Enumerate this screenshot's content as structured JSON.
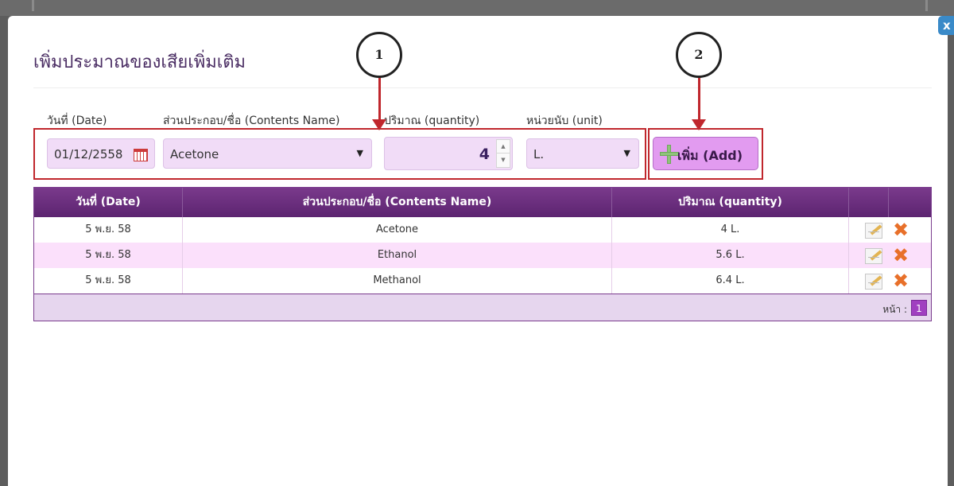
{
  "modal": {
    "title": "เพิ่มประมาณของเสียเพิ่มเติม",
    "close_label": "x"
  },
  "form": {
    "date_label": "วันที่ (Date)",
    "contents_label": "ส่วนประกอบ/ชื่อ (Contents Name)",
    "quantity_label": "ปริมาณ (quantity)",
    "unit_label": "หน่วยนับ (unit)",
    "date_value": "01/12/2558",
    "contents_value": "Acetone",
    "quantity_value": "4",
    "unit_value": "L.",
    "add_label": "เพิ่ม (Add)"
  },
  "annotations": {
    "marker_1": "1",
    "marker_2": "2",
    "color": "#c0272d"
  },
  "table": {
    "headers": [
      "วันที่ (Date)",
      "ส่วนประกอบ/ชื่อ (Contents Name)",
      "ปริมาณ (quantity)"
    ],
    "rows": [
      {
        "date": "5 พ.ย. 58",
        "name": "Acetone",
        "quantity": "4 L."
      },
      {
        "date": "5 พ.ย. 58",
        "name": "Ethanol",
        "quantity": "5.6 L."
      },
      {
        "date": "5 พ.ย. 58",
        "name": "Methanol",
        "quantity": "6.4 L."
      }
    ],
    "page_label": "หน้า :",
    "current_page": "1"
  },
  "colors": {
    "header_purple": "#6b2f80",
    "input_bg": "#f1dcf7",
    "add_button": "#e29bf0"
  }
}
